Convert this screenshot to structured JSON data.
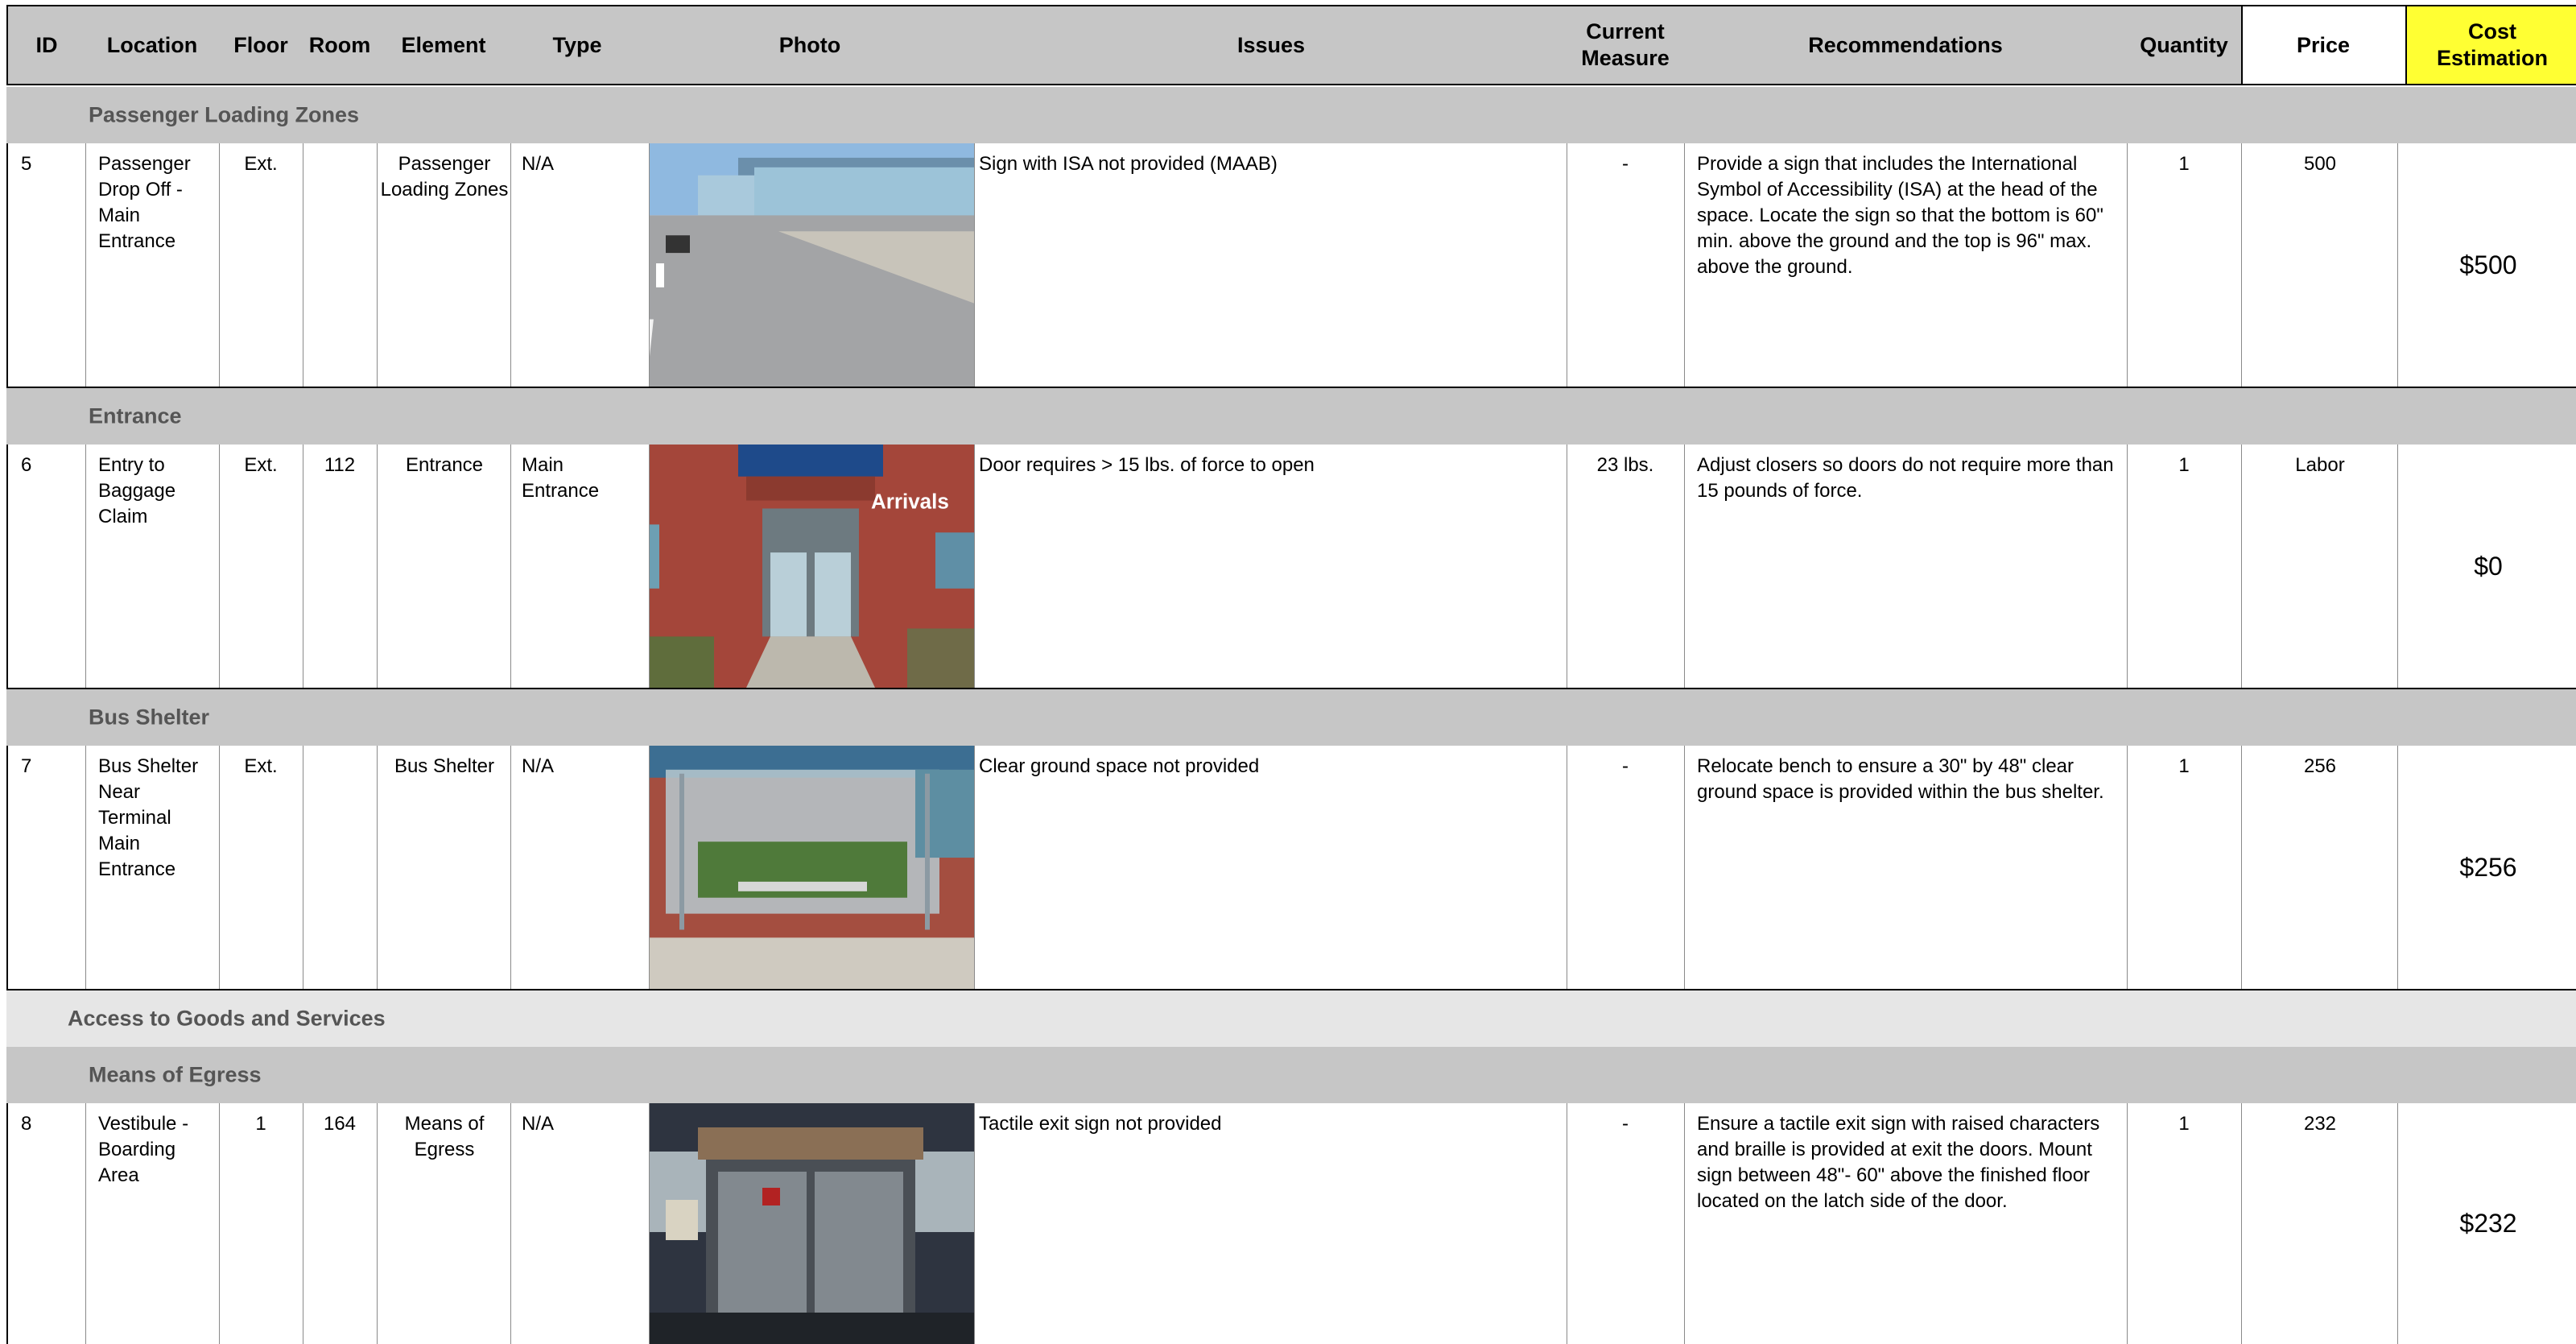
{
  "header": {
    "id": "ID",
    "location": "Location",
    "floor": "Floor",
    "room": "Room",
    "element": "Element",
    "type": "Type",
    "photo": "Photo",
    "issues": "Issues",
    "current_measure": "Current Measure",
    "recommendations": "Recommendations",
    "quantity": "Quantity",
    "price": "Price",
    "cost_estimation": "Cost Estimation"
  },
  "colors": {
    "header_bg": "#c6c6c6",
    "band_bg": "#c6c6c6",
    "section_band_bg": "#e6e6e6",
    "cost_header_bg": "#ffff33",
    "band_text": "#555555"
  },
  "sections": {
    "access": "Access to Goods and Services"
  },
  "rows": [
    {
      "band": "Passenger Loading Zones",
      "id": "5",
      "location": "Passenger Drop Off - Main Entrance",
      "floor": "Ext.",
      "room": "",
      "element": "Passenger Loading Zones",
      "type": "N/A",
      "photo_icon": "photo-passenger-dropoff",
      "issues": "Sign with ISA not provided (MAAB)",
      "current_measure": "-",
      "recommendations": "Provide a sign that includes the International Symbol of Accessibility (ISA) at the head of the space.  Locate the sign so that the bottom is 60\" min. above the ground and the top is 96\" max. above the ground.",
      "quantity": "1",
      "price": "500",
      "cost": "$500"
    },
    {
      "band": "Entrance",
      "id": "6",
      "location": "Entry to Baggage Claim",
      "floor": "Ext.",
      "room": "112",
      "element": "Entrance",
      "type": "Main Entrance",
      "photo_icon": "photo-arrivals-entrance",
      "photo_sign": "Arrivals",
      "issues": "Door requires  > 15 lbs. of force to open",
      "current_measure": "23 lbs.",
      "recommendations": "Adjust closers so doors do not require more than 15 pounds of force.",
      "quantity": "1",
      "price": "Labor",
      "cost": "$0"
    },
    {
      "band": "Bus Shelter",
      "id": "7",
      "location": "Bus Shelter Near Terminal Main Entrance",
      "floor": "Ext.",
      "room": "",
      "element": "Bus Shelter",
      "type": "N/A",
      "photo_icon": "photo-bus-shelter",
      "issues": "Clear ground space not provided",
      "current_measure": "-",
      "recommendations": "Relocate bench to ensure a 30\" by 48\" clear ground space is provided within the bus shelter.",
      "quantity": "1",
      "price": "256",
      "cost": "$256"
    },
    {
      "band": "Means of Egress",
      "id": "8",
      "location": "Vestibule - Boarding Area",
      "floor": "1",
      "room": "164",
      "element": "Means of Egress",
      "type": "N/A",
      "photo_icon": "photo-vestibule",
      "issues": "Tactile exit sign not provided",
      "current_measure": "-",
      "recommendations": "Ensure a tactile exit sign with raised characters and braille is provided at exit the doors. Mount sign between 48\"- 60\" above the finished floor located on the latch side of the door.",
      "quantity": "1",
      "price": "232",
      "cost": "$232"
    }
  ]
}
